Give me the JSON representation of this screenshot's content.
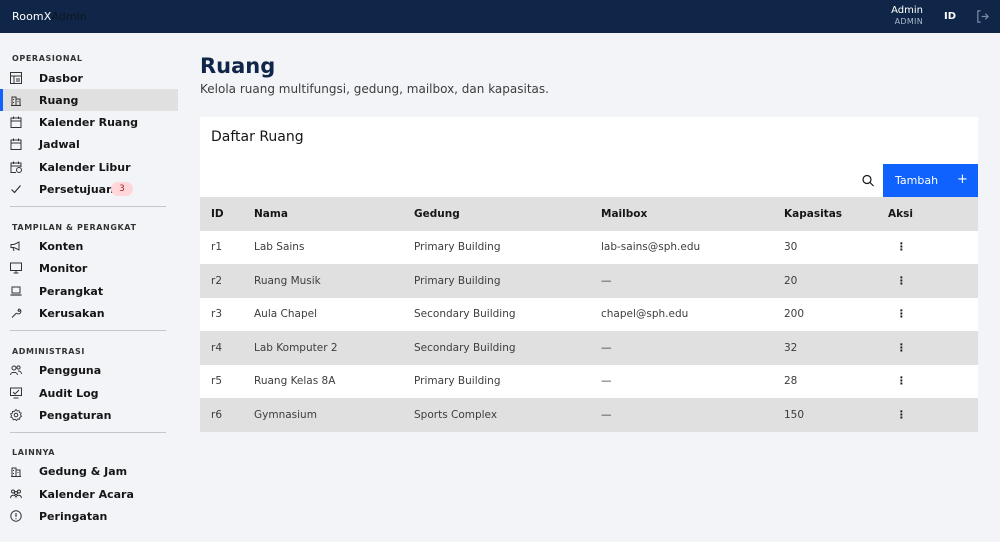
{
  "header": {
    "brand_primary": "RoomX",
    "brand_secondary": "Admin",
    "user_name": "Admin",
    "user_role": "ADMIN",
    "language": "ID"
  },
  "sidebar": {
    "sections": [
      {
        "title": "OPERASIONAL",
        "items": [
          {
            "label": "Dasbor",
            "icon": "dashboard-icon"
          },
          {
            "label": "Ruang",
            "icon": "building-icon",
            "active": true
          },
          {
            "label": "Kalender Ruang",
            "icon": "calendar-icon"
          },
          {
            "label": "Jadwal",
            "icon": "calendar-icon"
          },
          {
            "label": "Kalender Libur",
            "icon": "calendar-clock-icon"
          },
          {
            "label": "Persetujuan",
            "icon": "checkmark-icon",
            "badge": "3"
          }
        ]
      },
      {
        "title": "TAMPILAN & PERANGKAT",
        "items": [
          {
            "label": "Konten",
            "icon": "megaphone-icon"
          },
          {
            "label": "Monitor",
            "icon": "monitor-icon"
          },
          {
            "label": "Perangkat",
            "icon": "laptop-icon"
          },
          {
            "label": "Kerusakan",
            "icon": "wrench-icon"
          }
        ]
      },
      {
        "title": "ADMINISTRASI",
        "items": [
          {
            "label": "Pengguna",
            "icon": "user-multiple-icon"
          },
          {
            "label": "Audit Log",
            "icon": "audit-icon"
          },
          {
            "label": "Pengaturan",
            "icon": "gear-icon"
          }
        ]
      },
      {
        "title": "LAINNYA",
        "items": [
          {
            "label": "Gedung & Jam",
            "icon": "building-icon"
          },
          {
            "label": "Kalender Acara",
            "icon": "events-icon"
          },
          {
            "label": "Peringatan",
            "icon": "warning-icon"
          }
        ]
      }
    ]
  },
  "main": {
    "title": "Ruang",
    "subtitle": "Kelola ruang multifungsi, gedung, mailbox, dan kapasitas.",
    "card_title": "Daftar Ruang",
    "add_label": "Tambah",
    "add_symbol": "+",
    "row_action_symbol": "⋮",
    "columns": [
      "ID",
      "Nama",
      "Gedung",
      "Mailbox",
      "Kapasitas",
      "Aksi"
    ],
    "rows": [
      {
        "id": "r1",
        "nama": "Lab Sains",
        "gedung": "Primary Building",
        "mailbox": "lab-sains@sph.edu",
        "kapasitas": "30"
      },
      {
        "id": "r2",
        "nama": "Ruang Musik",
        "gedung": "Primary Building",
        "mailbox": "—",
        "kapasitas": "20"
      },
      {
        "id": "r3",
        "nama": "Aula Chapel",
        "gedung": "Secondary Building",
        "mailbox": "chapel@sph.edu",
        "kapasitas": "200"
      },
      {
        "id": "r4",
        "nama": "Lab Komputer 2",
        "gedung": "Secondary Building",
        "mailbox": "—",
        "kapasitas": "32"
      },
      {
        "id": "r5",
        "nama": "Ruang Kelas 8A",
        "gedung": "Primary Building",
        "mailbox": "—",
        "kapasitas": "28"
      },
      {
        "id": "r6",
        "nama": "Gymnasium",
        "gedung": "Sports Complex",
        "mailbox": "—",
        "kapasitas": "150"
      }
    ]
  },
  "colors": {
    "header_bg": "#0f2648",
    "accent": "#0f62fe",
    "badge_bg": "#ffd7d9",
    "badge_fg": "#a2191f",
    "row_alt": "#e0e0e0"
  }
}
